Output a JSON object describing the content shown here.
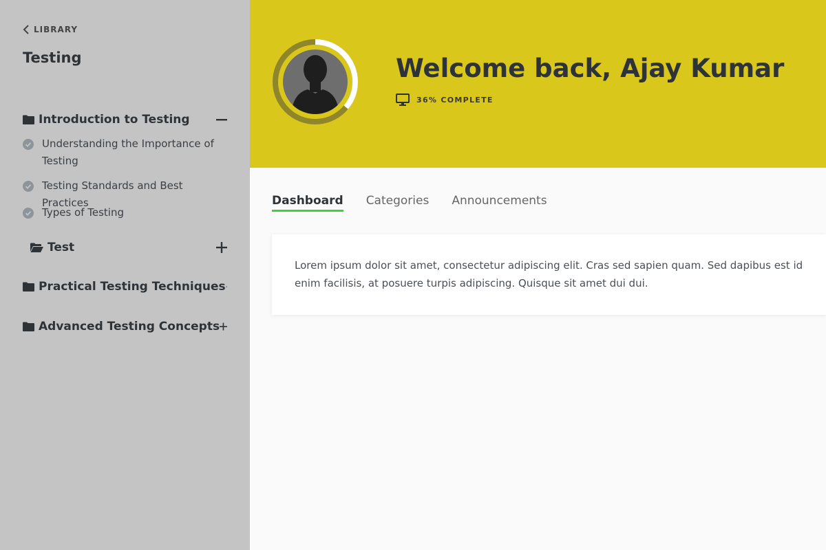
{
  "sidebar": {
    "back_label": "LIBRARY",
    "course_title": "Testing",
    "sections": [
      {
        "label": "Introduction to Testing",
        "expanded": true,
        "lessons": [
          "Understanding the Importance of Testing",
          "Testing Standards and Best Practices",
          "Types of Testing"
        ]
      },
      {
        "label": "Test",
        "expanded": false
      },
      {
        "label": "Practical Testing Techniques",
        "expanded": false
      },
      {
        "label": "Advanced Testing Concepts",
        "expanded": false
      }
    ]
  },
  "header": {
    "welcome": "Welcome back, Ajay Kumar",
    "progress_text": "36% COMPLETE",
    "progress_fraction": 0.36
  },
  "tabs": [
    {
      "label": "Dashboard",
      "active": true
    },
    {
      "label": "Categories",
      "active": false
    },
    {
      "label": "Announcements",
      "active": false
    }
  ],
  "card": {
    "text": "Lorem ipsum dolor sit amet, consectetur adipiscing elit. Cras sed sapien quam. Sed dapibus est id enim facilisis, at posuere turpis adipiscing. Quisque sit amet dui dui."
  },
  "colors": {
    "banner": "#dac71c",
    "sidebar": "#c4c4c4",
    "tab_underline": "#34d63a",
    "progress_ring": "#ffffff",
    "progress_track": "#8f852a"
  }
}
